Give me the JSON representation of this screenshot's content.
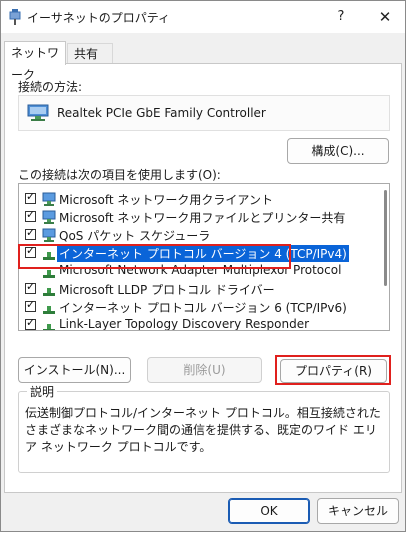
{
  "window": {
    "title": "イーサネットのプロパティ",
    "help_glyph": "?",
    "close_glyph": "✕"
  },
  "tabs": [
    {
      "label": "ネットワーク",
      "active": true
    },
    {
      "label": "共有",
      "active": false
    }
  ],
  "connection": {
    "method_label": "接続の方法:",
    "adapter_name": "Realtek PCIe GbE Family Controller",
    "configure_button": "構成(C)..."
  },
  "items": {
    "label": "この接続は次の項目を使用します(O):",
    "list": [
      {
        "label": "Microsoft ネットワーク用クライアント",
        "checked": true,
        "icon": "network-client-icon"
      },
      {
        "label": "Microsoft ネットワーク用ファイルとプリンター共有",
        "checked": true,
        "icon": "file-share-icon"
      },
      {
        "label": "QoS パケット スケジューラ",
        "checked": true,
        "icon": "qos-icon"
      },
      {
        "label": "インターネット プロトコル バージョン 4 (TCP/IPv4)",
        "checked": true,
        "icon": "protocol-icon",
        "selected": true
      },
      {
        "label": "Microsoft Network Adapter Multiplexor Protocol",
        "checked": false,
        "icon": "protocol-icon"
      },
      {
        "label": "Microsoft LLDP プロトコル ドライバー",
        "checked": true,
        "icon": "protocol-icon"
      },
      {
        "label": "インターネット プロトコル バージョン 6 (TCP/IPv6)",
        "checked": true,
        "icon": "protocol-icon"
      },
      {
        "label": "Link-Layer Topology Discovery Responder",
        "checked": true,
        "icon": "protocol-icon"
      }
    ]
  },
  "buttons": {
    "install": "インストール(N)...",
    "uninstall": "削除(U)",
    "properties": "プロパティ(R)",
    "ok": "OK",
    "cancel": "キャンセル"
  },
  "description": {
    "title": "説明",
    "text": "伝送制御プロトコル/インターネット プロトコル。相互接続されたさまざまなネットワーク間の通信を提供する、既定のワイド エリア ネットワーク プロトコルです。"
  },
  "colors": {
    "selection": "#0a64d8",
    "highlight": "#e0201d",
    "accent": "#1a5bb3"
  }
}
